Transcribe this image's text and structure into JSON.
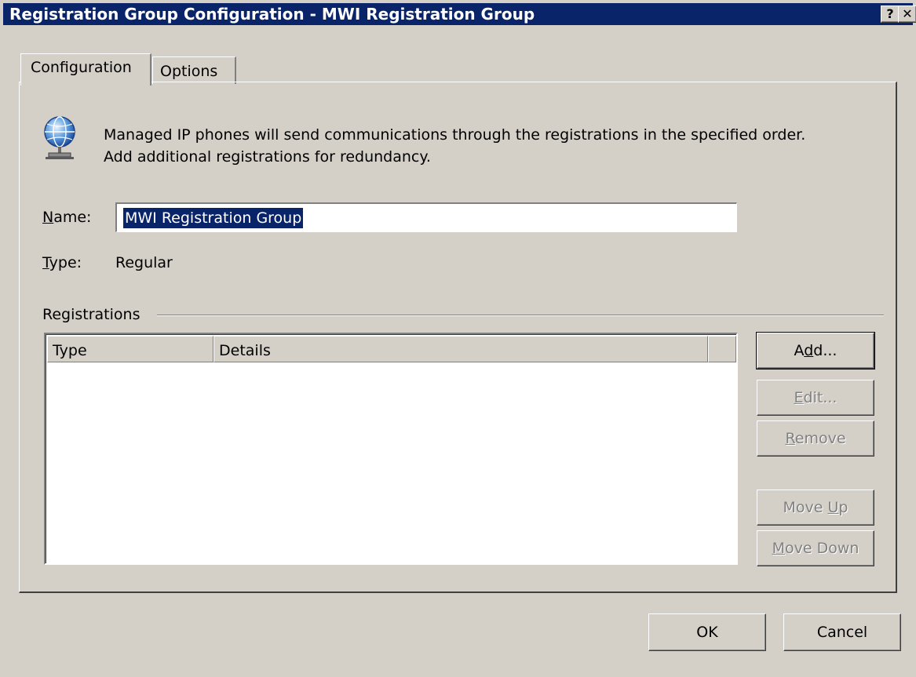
{
  "window": {
    "title": "Registration Group Configuration - MWI Registration Group",
    "help_glyph": "?",
    "close_glyph": "✕"
  },
  "tabs": [
    {
      "label": "Configuration",
      "selected": true
    },
    {
      "label": "Options",
      "selected": false
    }
  ],
  "description": {
    "line1": "Managed IP phones will send communications through the registrations in the specified order.",
    "line2": "Add additional registrations for redundancy.",
    "icon": "globe-network-icon"
  },
  "form": {
    "name_label_key": "N",
    "name_label_rest": "ame:",
    "name_value": "MWI Registration Group",
    "type_label_key": "T",
    "type_label_rest": "ype:",
    "type_value": "Regular"
  },
  "registrations": {
    "group_label": "Registrations",
    "columns": [
      "Type",
      "Details"
    ],
    "rows": []
  },
  "side_buttons": {
    "add_pre": "A",
    "add_key": "d",
    "add_post": "d...",
    "edit_pre": "",
    "edit_key": "E",
    "edit_post": "dit...",
    "remove_pre": "",
    "remove_key": "R",
    "remove_post": "emove",
    "moveup_pre": "Move ",
    "moveup_key": "U",
    "moveup_post": "p",
    "movedown_pre": "",
    "movedown_key": "M",
    "movedown_post": "ove Down"
  },
  "footer": {
    "ok_label": "OK",
    "cancel_label": "Cancel"
  },
  "colors": {
    "titlebar": "#0a246a",
    "dialog_face": "#d4d0c8",
    "selection": "#0a246a",
    "disabled_text": "#808080"
  }
}
